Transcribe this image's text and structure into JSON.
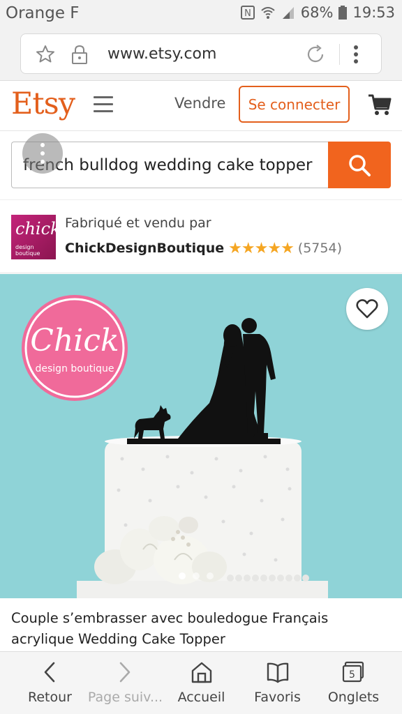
{
  "status_bar": {
    "carrier": "Orange F",
    "battery": "68%",
    "time": "19:53"
  },
  "browser": {
    "url": "www.etsy.com"
  },
  "header": {
    "logo": "Etsy",
    "sell_label": "Vendre",
    "signin_label": "Se connecter"
  },
  "search": {
    "query": "french bulldog wedding cake topper"
  },
  "seller": {
    "made_by_label": "Fabriqué et vendu par",
    "shop_name": "ChickDesignBoutique",
    "rating_stars": "★★★★★",
    "rating": 5,
    "review_count": "(5754)",
    "logo_text": "chick",
    "logo_subtext": "design boutique"
  },
  "product": {
    "image_badge_title": "Chick",
    "image_badge_subtitle": "design boutique",
    "title": "Couple s’embrasser avec bouledogue Français acrylique Wedding Cake Topper",
    "carousel_active_index": 0,
    "carousel_count": 3
  },
  "bottom_nav": {
    "back": "Retour",
    "forward": "Page suiv...",
    "home": "Accueil",
    "bookmarks": "Favoris",
    "tabs": "Onglets",
    "tabs_count": "5"
  },
  "colors": {
    "etsy_orange": "#f1641e",
    "product_bg": "#8fd3d7",
    "badge_pink": "#f06a9a",
    "star": "#f5a623"
  }
}
